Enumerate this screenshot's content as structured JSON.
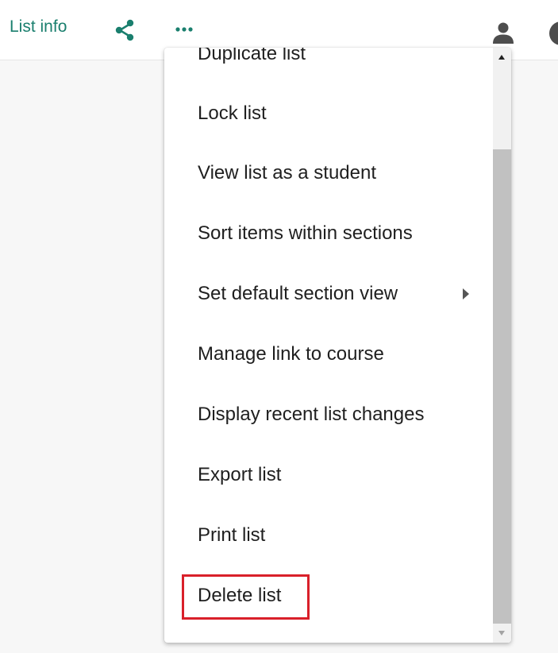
{
  "toolbar": {
    "list_info_label": "List info",
    "accent_color": "#1a7f6e",
    "icons": [
      "share-icon",
      "more-icon",
      "person-icon",
      "avatar"
    ]
  },
  "menu": {
    "items": [
      {
        "label": "Duplicate list"
      },
      {
        "label": "Lock list"
      },
      {
        "label": "View list as a student"
      },
      {
        "label": "Sort items within sections"
      },
      {
        "label": "Set default section view",
        "has_submenu": true
      },
      {
        "label": "Manage link to course"
      },
      {
        "label": "Display recent list changes"
      },
      {
        "label": "Export list"
      },
      {
        "label": "Print list"
      },
      {
        "label": "Delete list",
        "highlighted": true
      }
    ],
    "highlight_color": "#d9202a"
  }
}
